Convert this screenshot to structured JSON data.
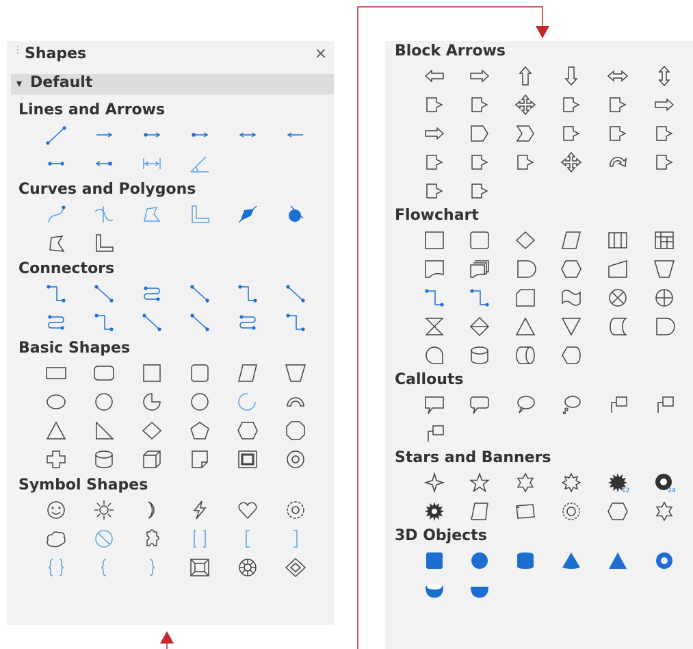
{
  "left_panel": {
    "title": "Shapes",
    "close_glyph": "×",
    "grip_glyph": "⋮",
    "default_group": {
      "triangle": "▾",
      "label": "Default"
    },
    "sections": [
      {
        "title": "Lines and Arrows",
        "icons": [
          "line-icon",
          "line-ends-with-arrow-icon",
          "line-with-circle-arrow-icon",
          "line-with-square-arrow-icon",
          "line-with-arrows-icon",
          "line-starts-with-arrow-icon",
          "line-with-circles-icon",
          "line-square-circle-icon",
          "dimension-line-icon",
          "line-angle-45-icon"
        ]
      },
      {
        "title": "Curves and Polygons",
        "icons": [
          "curve-icon",
          "freeform-line-icon",
          "polygon-icon",
          "polygon-45-icon",
          "filled-curve-icon",
          "filled-freeform-icon",
          "filled-polygon-icon",
          "filled-polygon-45-icon"
        ]
      },
      {
        "title": "Connectors",
        "icons": [
          "connector-icon",
          "straight-connector-icon",
          "curved-connector-icon",
          "line-connector-icon",
          "connector-ends-with-arrow-icon",
          "straight-connector-arrow-icon",
          "curved-connector-arrow-icon",
          "connector-with-circles-icon",
          "straight-connector-circles-icon",
          "line-connector-arrows-icon",
          "curved-connector-circles-icon",
          "connector-circles-end-icon"
        ]
      },
      {
        "title": "Basic Shapes",
        "icons": [
          "rectangle-icon",
          "rectangle-rounded-icon",
          "square-icon",
          "square-rounded-icon",
          "parallelogram-icon",
          "trapezoid-icon",
          "ellipse-icon",
          "circle-icon",
          "circle-pie-icon",
          "diamond-rounded-icon",
          "block-arc-icon",
          "arc-icon",
          "isosceles-triangle-icon",
          "right-triangle-icon",
          "diamond-icon",
          "pentagon-icon",
          "hexagon-icon",
          "octagon-icon",
          "cross-icon",
          "cylinder-icon",
          "cube-icon",
          "folded-corner-icon",
          "frame-icon",
          "ring-icon"
        ]
      },
      {
        "title": "Symbol Shapes",
        "icons": [
          "smiley-icon",
          "sun-icon",
          "moon-icon",
          "lightning-icon",
          "heart-icon",
          "flower-icon",
          "cloud-icon",
          "prohibited-icon",
          "puzzle-icon",
          "bracket-pair-icon",
          "left-bracket-icon",
          "right-bracket-icon",
          "brace-pair-icon",
          "left-brace-icon",
          "right-brace-icon",
          "square-bevel-icon",
          "octagon-bevel-icon",
          "diamond-bevel-icon"
        ]
      }
    ]
  },
  "right_panel": {
    "sections": [
      {
        "title": "Block Arrows",
        "icons": [
          "left-arrow-icon",
          "right-arrow-icon",
          "up-arrow-icon",
          "down-arrow-icon",
          "left-right-arrow-icon",
          "up-down-arrow-icon",
          "up-right-arrow-icon",
          "up-right-down-arrow-icon",
          "four-way-arrow-icon",
          "corner-right-arrow-icon",
          "split-arrow-icon",
          "striped-right-arrow-icon",
          "notched-right-arrow-icon",
          "pentagon-arrow-icon",
          "chevron-icon",
          "right-arrow-callout-icon",
          "left-arrow-callout-icon",
          "up-arrow-callout-icon",
          "left-right-arrow-callout-icon",
          "up-down-arrow-callout-icon",
          "up-right-arrow-callout-icon",
          "four-way-arrow-callout-icon",
          "circular-arrow-icon",
          "down-arrow-callout-icon",
          "split-round-arrow-icon",
          "s-sharped-arrow-icon"
        ]
      },
      {
        "title": "Flowchart",
        "icons": [
          "flowchart-process-icon",
          "flowchart-alternate-process-icon",
          "flowchart-decision-icon",
          "flowchart-data-icon",
          "flowchart-predefined-process-icon",
          "flowchart-internal-storage-icon",
          "flowchart-document-icon",
          "flowchart-multidocument-icon",
          "flowchart-terminator-icon",
          "flowchart-preparation-icon",
          "flowchart-manual-input-icon",
          "flowchart-manual-operation-icon",
          "flowchart-connector-icon",
          "flowchart-off-page-connector-icon",
          "flowchart-card-icon",
          "flowchart-punched-tape-icon",
          "flowchart-summing-junction-icon",
          "flowchart-or-icon",
          "flowchart-collate-icon",
          "flowchart-sort-icon",
          "flowchart-extract-icon",
          "flowchart-merge-icon",
          "flowchart-stored-data-icon",
          "flowchart-delay-icon",
          "flowchart-sequential-access-icon",
          "flowchart-magnetic-disc-icon",
          "flowchart-direct-access-storage-icon",
          "flowchart-display-icon"
        ]
      },
      {
        "title": "Callouts",
        "icons": [
          "rectangular-callout-icon",
          "round-rectangular-callout-icon",
          "round-callout-icon",
          "cloud-callout-icon",
          "line-callout-1-icon",
          "line-callout-2-icon",
          "line-callout-3-icon"
        ]
      },
      {
        "title": "Stars and Banners",
        "icons": [
          "star-4-icon",
          "star-5-icon",
          "star-6-icon",
          "star-8-icon",
          "star-12-icon",
          "star-24-icon",
          "explosion-icon",
          "vertical-scroll-icon",
          "horizontal-scroll-icon",
          "signet-icon",
          "doorplate-icon",
          "concave-star-6-icon"
        ]
      },
      {
        "title": "3D Objects",
        "icons": [
          "cube-3d-icon",
          "sphere-3d-icon",
          "cylinder-3d-icon",
          "cone-3d-icon",
          "pyramid-3d-icon",
          "torus-3d-icon",
          "shell-3d-icon",
          "half-sphere-3d-icon"
        ]
      }
    ]
  },
  "colors": {
    "panel_bg": "#f2f2f2",
    "default_bar_bg": "#dcdcdc",
    "icon_gray": "#444444",
    "icon_blue": "#1c6fd1",
    "icon_light_blue": "#5aa0e6",
    "connector_arrow": "#c0282d"
  }
}
